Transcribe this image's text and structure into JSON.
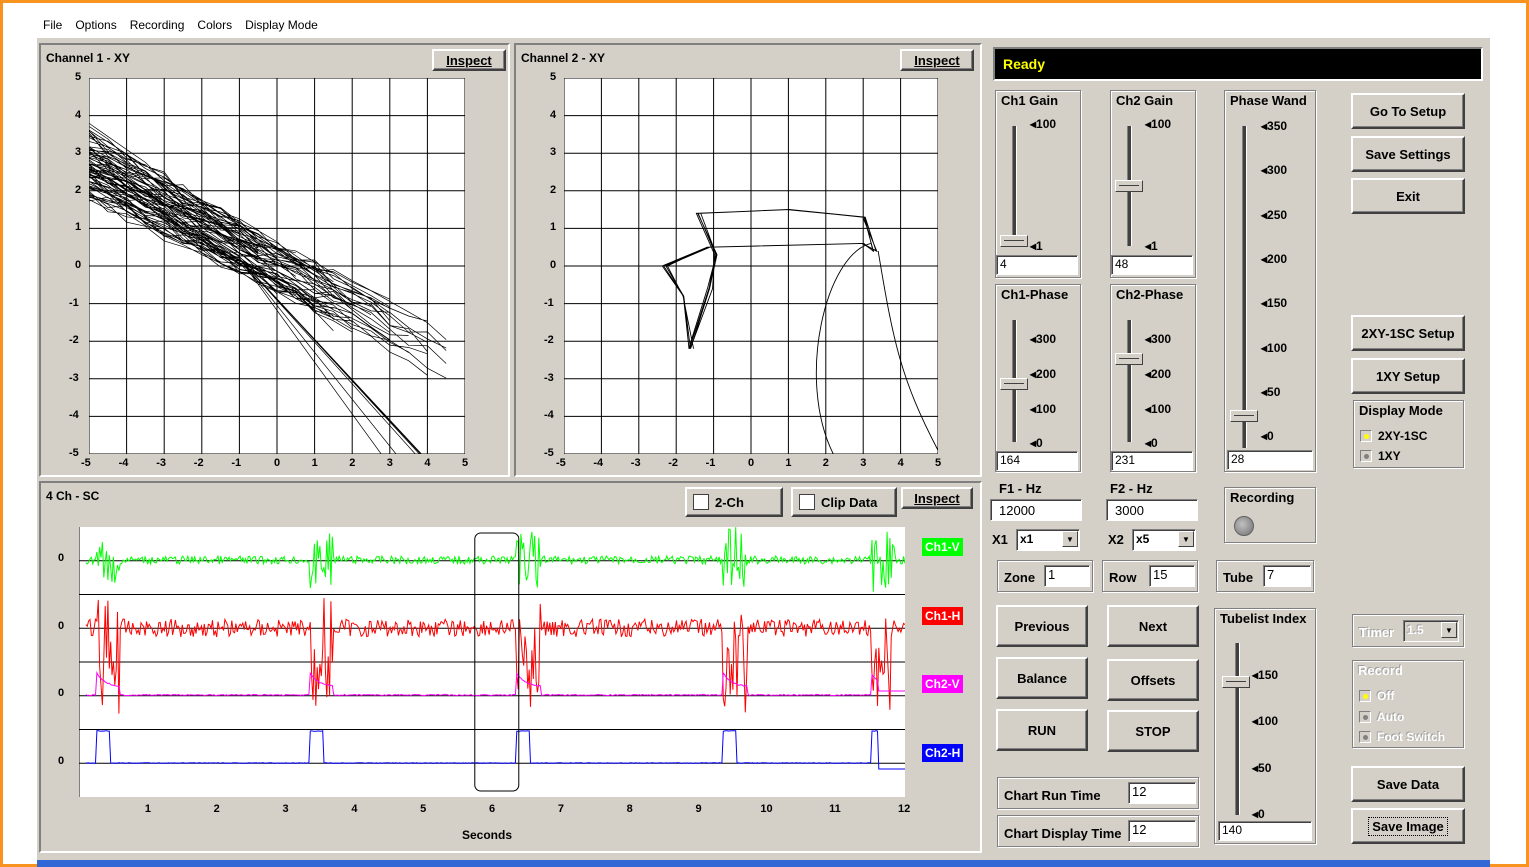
{
  "menu": [
    "File",
    "Options",
    "Recording",
    "Colors",
    "Display Mode"
  ],
  "status": "Ready",
  "channel1": {
    "title": "Channel 1 - XY",
    "inspect": "Inspect",
    "y_ticks": [
      "5",
      "4",
      "3",
      "2",
      "1",
      "0",
      "-1",
      "-2",
      "-3",
      "-4",
      "-5"
    ],
    "x_ticks": [
      "-5",
      "-4",
      "-3",
      "-2",
      "-1",
      "0",
      "1",
      "2",
      "3",
      "4",
      "5"
    ]
  },
  "channel2": {
    "title": "Channel 2 - XY",
    "inspect": "Inspect",
    "y_ticks": [
      "5",
      "4",
      "3",
      "2",
      "1",
      "0",
      "-1",
      "-2",
      "-3",
      "-4",
      "-5"
    ],
    "x_ticks": [
      "-5",
      "-4",
      "-3",
      "-2",
      "-1",
      "0",
      "1",
      "2",
      "3",
      "4",
      "5"
    ]
  },
  "strip": {
    "title": "4 Ch - SC",
    "two_ch": "2-Ch",
    "clip_data": "Clip Data",
    "inspect": "Inspect",
    "y_labels": [
      "0",
      "0",
      "0",
      "0"
    ],
    "x_ticks": [
      "1",
      "2",
      "3",
      "4",
      "5",
      "6",
      "7",
      "8",
      "9",
      "10",
      "11",
      "12"
    ],
    "x_label": "Seconds",
    "channels": [
      {
        "name": "Ch1-V",
        "color": "#00ff00"
      },
      {
        "name": "Ch1-H",
        "color": "#ff0000"
      },
      {
        "name": "Ch2-V",
        "color": "#ff00ff"
      },
      {
        "name": "Ch2-H",
        "color": "#0000ff"
      }
    ]
  },
  "ch1_gain": {
    "title": "Ch1 Gain",
    "labels": [
      "100",
      "1"
    ],
    "value": "4"
  },
  "ch2_gain": {
    "title": "Ch2 Gain",
    "labels": [
      "100",
      "1"
    ],
    "value": "48"
  },
  "ch1_phase": {
    "title": "Ch1-Phase",
    "labels": [
      "300",
      "200",
      "100",
      "0"
    ],
    "value": "164"
  },
  "ch2_phase": {
    "title": "Ch2-Phase",
    "labels": [
      "300",
      "200",
      "100",
      "0"
    ],
    "value": "231"
  },
  "phase_wand": {
    "title": "Phase Wand",
    "labels": [
      "350",
      "300",
      "250",
      "200",
      "150",
      "100",
      "50",
      "0"
    ],
    "value": "28"
  },
  "f1": {
    "label": "F1 - Hz",
    "value": "12000",
    "mult_label": "X1",
    "mult": "x1"
  },
  "f2": {
    "label": "F2 - Hz",
    "value": "3000",
    "mult_label": "X2",
    "mult": "x5"
  },
  "recording": {
    "title": "Recording"
  },
  "zone": {
    "label": "Zone",
    "value": "1"
  },
  "row": {
    "label": "Row",
    "value": "15"
  },
  "tube": {
    "label": "Tube",
    "value": "7"
  },
  "buttons": {
    "previous": "Previous",
    "next": "Next",
    "balance": "Balance",
    "offsets": "Offsets",
    "run": "RUN",
    "stop": "STOP",
    "go_to_setup": "Go To Setup",
    "save_settings": "Save Settings",
    "exit": "Exit",
    "setup_2xy": "2XY-1SC Setup",
    "setup_1xy": "1XY Setup",
    "save_data": "Save Data",
    "save_image": "Save Image"
  },
  "tubelist": {
    "title": "Tubelist Index",
    "labels": [
      "150",
      "100",
      "50",
      "0"
    ],
    "value": "140"
  },
  "chart_run_time": {
    "label": "Chart Run Time",
    "value": "12"
  },
  "chart_display_time": {
    "label": "Chart Display Time",
    "value": "12"
  },
  "display_mode": {
    "title": "Display Mode",
    "options": [
      "2XY-1SC",
      "1XY"
    ]
  },
  "timer": {
    "label": "Timer",
    "value": "1.5"
  },
  "record": {
    "title": "Record",
    "options": [
      "Off",
      "Auto",
      "Foot Switch"
    ]
  }
}
